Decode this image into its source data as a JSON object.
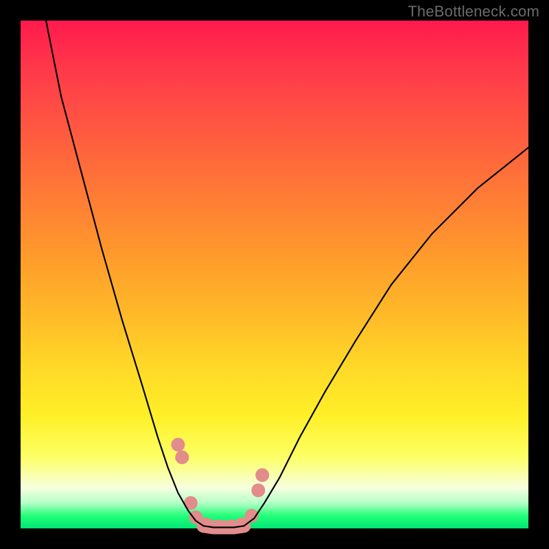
{
  "watermark": {
    "text": "TheBottleneck.com"
  },
  "chart_data": {
    "type": "line",
    "title": "",
    "xlabel": "",
    "ylabel": "",
    "xlim": [
      0,
      100
    ],
    "ylim": [
      0,
      100
    ],
    "series": [
      {
        "name": "left-curve",
        "x": [
          5,
          8,
          12,
          16,
          20,
          24,
          27,
          29,
          31,
          33,
          34.5,
          36
        ],
        "y": [
          100,
          85,
          70,
          55,
          41,
          28,
          18,
          12,
          7,
          3.5,
          1.5,
          0.5
        ]
      },
      {
        "name": "right-curve",
        "x": [
          44,
          46,
          48,
          51,
          55,
          60,
          66,
          73,
          81,
          90,
          100
        ],
        "y": [
          0.5,
          2,
          5,
          10,
          18,
          27,
          37,
          48,
          58,
          67,
          75
        ]
      },
      {
        "name": "valley-floor",
        "x": [
          36,
          38,
          40,
          42,
          44
        ],
        "y": [
          0.5,
          0.2,
          0.2,
          0.2,
          0.5
        ]
      }
    ],
    "markers": {
      "name": "bead-markers",
      "color": "#e38c8c",
      "radius_px": 10,
      "points": [
        {
          "x": 31.0,
          "y": 16.5
        },
        {
          "x": 31.8,
          "y": 14.0
        },
        {
          "x": 33.5,
          "y": 5.0
        },
        {
          "x": 34.5,
          "y": 2.2
        },
        {
          "x": 36.5,
          "y": 0.8
        },
        {
          "x": 39.0,
          "y": 0.4
        },
        {
          "x": 41.5,
          "y": 0.4
        },
        {
          "x": 43.5,
          "y": 0.8
        },
        {
          "x": 45.5,
          "y": 2.5
        },
        {
          "x": 46.8,
          "y": 7.5
        },
        {
          "x": 47.6,
          "y": 10.5
        }
      ]
    }
  }
}
